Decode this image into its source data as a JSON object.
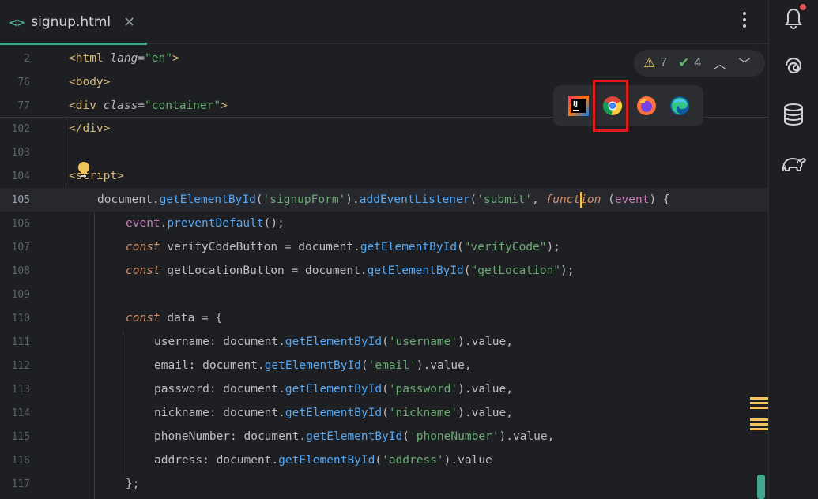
{
  "tab": {
    "icon": "<>",
    "filename": "signup.html",
    "close": "✕"
  },
  "inspections": {
    "warnings": "7",
    "weak_warnings": "4",
    "prev": "︿",
    "next": "﹀"
  },
  "browsers": [
    "intellij-builtin-preview",
    "chrome",
    "firefox",
    "edge"
  ],
  "tool_icons": [
    "notifications-icon",
    "ai-assistant-icon",
    "database-icon",
    "gradle-elephant-icon"
  ],
  "gutter": {
    "l2": "2",
    "l76": "76",
    "l77": "77",
    "l102": "102",
    "l103": "103",
    "l104": "104",
    "l105": "105",
    "l106": "106",
    "l107": "107",
    "l108": "108",
    "l109": "109",
    "l110": "110",
    "l111": "111",
    "l112": "112",
    "l113": "113",
    "l114": "114",
    "l115": "115",
    "l116": "116",
    "l117": "117"
  },
  "code": {
    "l2": {
      "t1": "<html ",
      "a1": "lang",
      "eq": "=",
      "s1": "\"en\"",
      "t2": ">"
    },
    "l76": {
      "t1": "<body>"
    },
    "l77": {
      "t1": "<div ",
      "a1": "class",
      "eq": "=",
      "s1": "\"container\"",
      "t2": ">"
    },
    "l102": {
      "t1": "</div>"
    },
    "l104": {
      "t1": "<script>"
    },
    "l105": {
      "p1": "document.",
      "f1": "getElementById",
      "p2": "(",
      "s1": "'signupForm'",
      "p3": ").",
      "f2": "addEventListener",
      "p4": "(",
      "s2": "'submit'",
      "p5": ", ",
      "k1": "function",
      "p6": " (",
      "v1": "event",
      "p7": ") {"
    },
    "l106": {
      "v1": "event",
      "p1": ".",
      "f1": "preventDefault",
      "p2": "();"
    },
    "l107": {
      "k1": "const",
      "p1": " verifyCodeButton = document.",
      "f1": "getElementById",
      "p2": "(",
      "s1": "\"verifyCode\"",
      "p3": ");"
    },
    "l108": {
      "k1": "const",
      "p1": " getLocationButton = document.",
      "f1": "getElementById",
      "p2": "(",
      "s1": "\"getLocation\"",
      "p3": ");"
    },
    "l110": {
      "k1": "const",
      "p1": " data = {"
    },
    "l111": {
      "p1": "username: document.",
      "f1": "getElementById",
      "p2": "(",
      "s1": "'username'",
      "p3": ").value,"
    },
    "l112": {
      "p1": "email: document.",
      "f1": "getElementById",
      "p2": "(",
      "s1": "'email'",
      "p3": ").value,"
    },
    "l113": {
      "p1": "password: document.",
      "f1": "getElementById",
      "p2": "(",
      "s1": "'password'",
      "p3": ").value,"
    },
    "l114": {
      "p1": "nickname: document.",
      "f1": "getElementById",
      "p2": "(",
      "s1": "'nickname'",
      "p3": ").value,"
    },
    "l115": {
      "p1": "phoneNumber: document.",
      "f1": "getElementById",
      "p2": "(",
      "s1": "'phoneNumber'",
      "p3": ").value,"
    },
    "l116": {
      "p1": "address: document.",
      "f1": "getElementById",
      "p2": "(",
      "s1": "'address'",
      "p3": ").value"
    },
    "l117": {
      "p1": "};"
    }
  },
  "colors": {
    "background": "#1e1f22",
    "accent": "#3fa88f",
    "highlight_box": "#e0191b",
    "warning": "#f2c55c"
  }
}
